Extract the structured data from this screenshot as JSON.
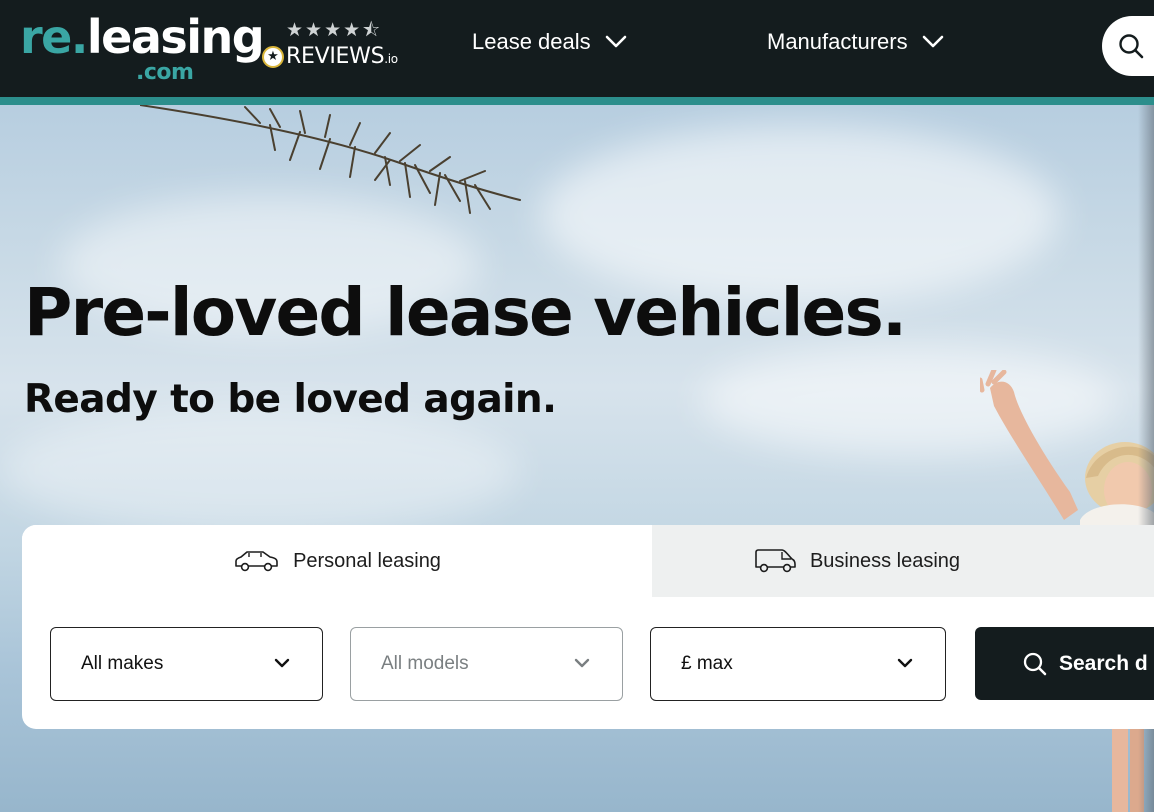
{
  "header": {
    "logo": {
      "re": "re.",
      "leasing": "leasing",
      "com": ".com"
    },
    "reviews": {
      "stars": "★★★★⯪",
      "rating_stars": 4.5,
      "name": "REVIEWS",
      "suffix": ".io"
    },
    "nav": [
      {
        "label": "Lease deals",
        "icon": "chevron-down-icon"
      },
      {
        "label": "Manufacturers",
        "icon": "chevron-down-icon"
      }
    ],
    "search_icon": "search-icon"
  },
  "hero": {
    "title": "Pre-loved lease vehicles.",
    "subtitle": "Ready to be loved again."
  },
  "search_panel": {
    "tabs": [
      {
        "label": "Personal leasing",
        "icon": "car-icon",
        "active": true
      },
      {
        "label": "Business leasing",
        "icon": "van-icon",
        "active": false
      }
    ],
    "makes": {
      "value": "All makes"
    },
    "models": {
      "value": "All models",
      "disabled": true
    },
    "budget": {
      "value": "£ max"
    },
    "search_button": {
      "label": "Search d"
    }
  },
  "colors": {
    "header_bg": "#141c1e",
    "brand_teal": "#3aa6a4",
    "stripe": "#2c8e8c",
    "button_bg": "#141c1e"
  }
}
